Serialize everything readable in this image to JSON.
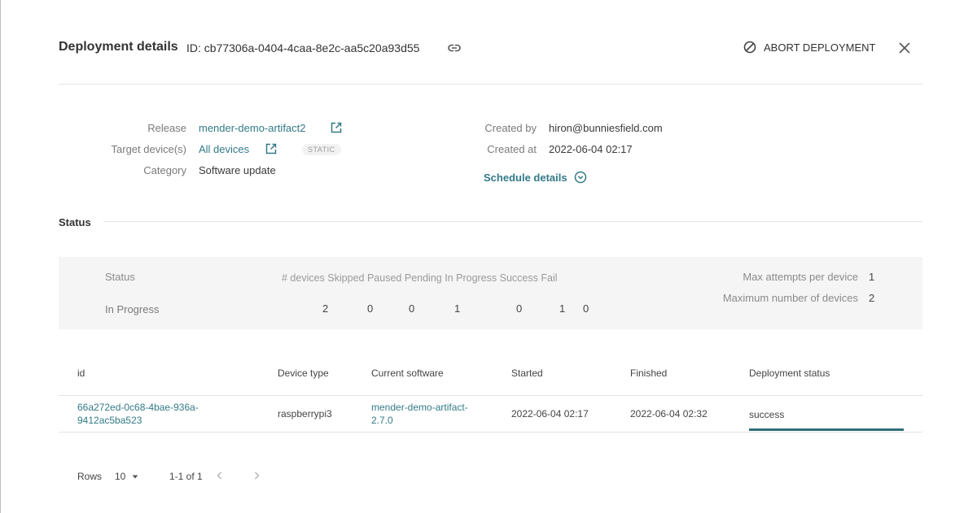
{
  "header": {
    "title": "Deployment details",
    "id_label": "ID: cb77306a-0404-4caa-8e2c-aa5c20a93d55",
    "abort_label": "ABORT DEPLOYMENT"
  },
  "overview": {
    "release_label": "Release",
    "release_value": "mender-demo-artifact2",
    "target_label": "Target device(s)",
    "target_value": "All devices",
    "target_badge": "STATIC",
    "category_label": "Category",
    "category_value": "Software update",
    "created_by_label": "Created by",
    "created_by_value": "hiron@bunniesfield.com",
    "created_at_label": "Created at",
    "created_at_value": "2022-06-04 02:17",
    "schedule_label": "Schedule details"
  },
  "status_section": {
    "title": "Status",
    "status_label": "Status",
    "status_value": "In Progress",
    "columns": [
      "# devices",
      "Skipped",
      "Paused",
      "Pending",
      "In Progress",
      "Success",
      "Fail"
    ],
    "counts": [
      "2",
      "0",
      "0",
      "1",
      "0",
      "1",
      "0"
    ],
    "max_attempts_label": "Max attempts per device",
    "max_attempts_value": "1",
    "max_devices_label": "Maximum number of devices",
    "max_devices_value": "2"
  },
  "table": {
    "headers": [
      "id",
      "Device type",
      "Current software",
      "Started",
      "Finished",
      "Deployment status"
    ],
    "rows": [
      {
        "id_line1": "66a272ed-0c68-4bae-936a-",
        "id_line2": "9412ac5ba523",
        "device_type": "raspberrypi3",
        "software_line1": "mender-demo-artifact-",
        "software_line2": "2.7.0",
        "started": "2022-06-04 02:17",
        "finished": "2022-06-04 02:32",
        "status": "success",
        "progress": 1.0
      }
    ]
  },
  "pagination": {
    "rows_label": "Rows",
    "rows_value": "10",
    "range": "1-1 of 1"
  },
  "colors": {
    "accent": "#337a87",
    "progress": "#2f6f78"
  }
}
